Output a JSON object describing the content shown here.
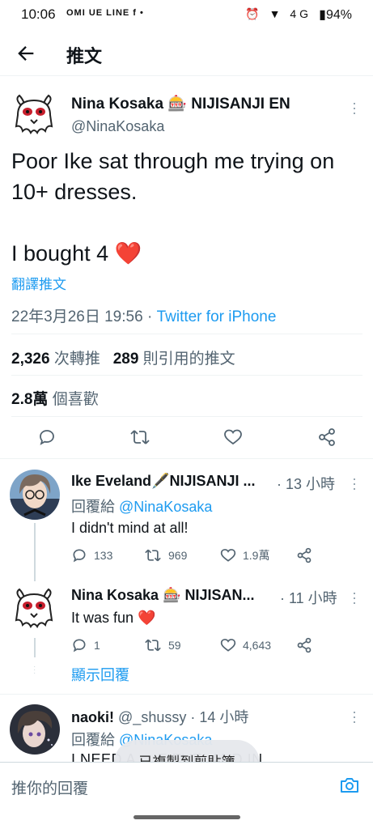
{
  "status_bar": {
    "time": "10:06",
    "notification_icons": "OMI UE LINE f •",
    "system_icons": "⏰ ▼ 4G",
    "battery": "94%"
  },
  "app_bar": {
    "title": "推文"
  },
  "main_tweet": {
    "display_name": "Nina Kosaka 🎰 NIJISANJI EN",
    "handle": "@NinaKosaka",
    "text": "Poor Ike sat through me trying on 10+ dresses.\n\nI bought 4",
    "heart": "❤️",
    "translate_label": "翻譯推文",
    "date": "22年3月26日 19:56",
    "separator": " · ",
    "source": "Twitter for iPhone",
    "retweets_count": "2,326",
    "retweets_label": "次轉推",
    "quotes_count": "289",
    "quotes_label": "則引用的推文",
    "likes_count": "2.8萬",
    "likes_label": "個喜歡"
  },
  "replies": [
    {
      "display_name": "Ike Eveland🖋️NIJISANJI ...",
      "time": "· 13 小時",
      "replying_prefix": "回覆給 ",
      "replying_to": "@NinaKosaka",
      "text": "I didn't mind at all!",
      "reply_count": "133",
      "retweet_count": "969",
      "like_count": "1.9萬"
    },
    {
      "display_name": "Nina Kosaka 🎰 NIJISAN...",
      "time": "· 11 小時",
      "text": "It was fun",
      "heart": "❤️",
      "reply_count": "1",
      "retweet_count": "59",
      "like_count": "4,643"
    },
    {
      "display_name": "naoki!",
      "handle": "@_shussy",
      "time": "· 14 小時",
      "replying_prefix": "回覆給 ",
      "replying_to": "@NinaKosaka",
      "text": "I NEED A ... E EVELAND IN"
    }
  ],
  "show_replies_label": "顯示回覆",
  "toast": "已複製到剪貼簿",
  "composer": {
    "placeholder": "推你的回覆"
  },
  "colors": {
    "accent": "#1d9bf0",
    "heart": "#e0245e",
    "secondary_text": "#536471"
  }
}
